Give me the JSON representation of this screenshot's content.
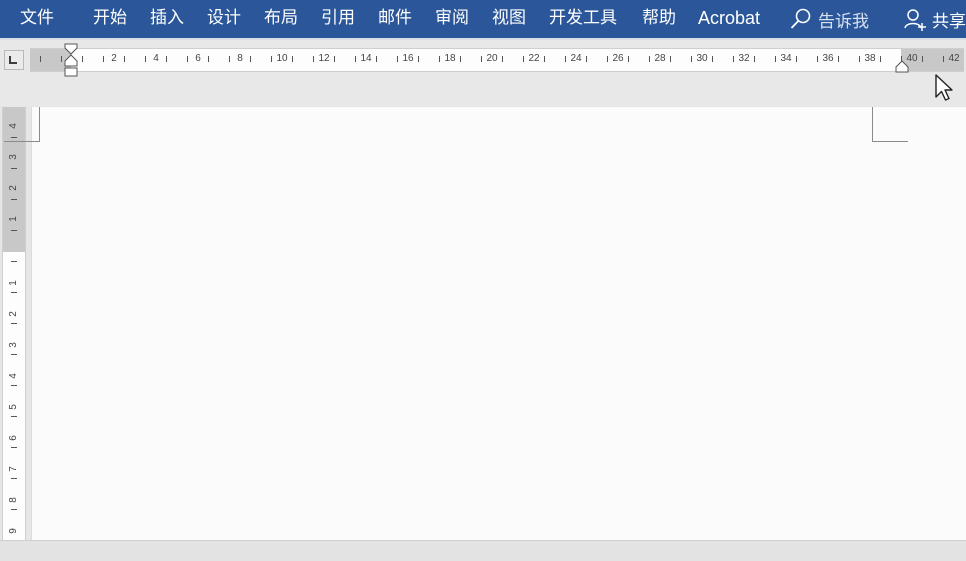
{
  "ribbon": {
    "tabs": [
      {
        "label": "文件"
      },
      {
        "label": "开始"
      },
      {
        "label": "插入"
      },
      {
        "label": "设计"
      },
      {
        "label": "布局"
      },
      {
        "label": "引用"
      },
      {
        "label": "邮件"
      },
      {
        "label": "审阅"
      },
      {
        "label": "视图"
      },
      {
        "label": "开发工具"
      },
      {
        "label": "帮助"
      },
      {
        "label": "Acrobat"
      }
    ],
    "tell_me_label": "告诉我",
    "share_label": "共享"
  },
  "horizontal_ruler": {
    "labels": [
      "2",
      "4",
      "6",
      "8",
      "10",
      "12",
      "14",
      "16",
      "18",
      "20",
      "22",
      "24",
      "26",
      "28",
      "30",
      "32",
      "34",
      "36",
      "38",
      "40",
      "42"
    ]
  },
  "vertical_ruler": {
    "top_margin_labels": [
      "4",
      "3",
      "2",
      "1"
    ],
    "body_labels": [
      "1",
      "2",
      "3",
      "4",
      "5",
      "6",
      "7",
      "8",
      "9"
    ]
  },
  "colors": {
    "ribbon_background": "#2b579a",
    "ruler_margin": "#c8c8c8",
    "page_background": "#fbfbfb"
  },
  "icons": {
    "tell_me": "search-icon",
    "share": "person-add-icon",
    "tab_selector": "left-tab-stop-icon",
    "cursor": "mouse-pointer-icon"
  }
}
